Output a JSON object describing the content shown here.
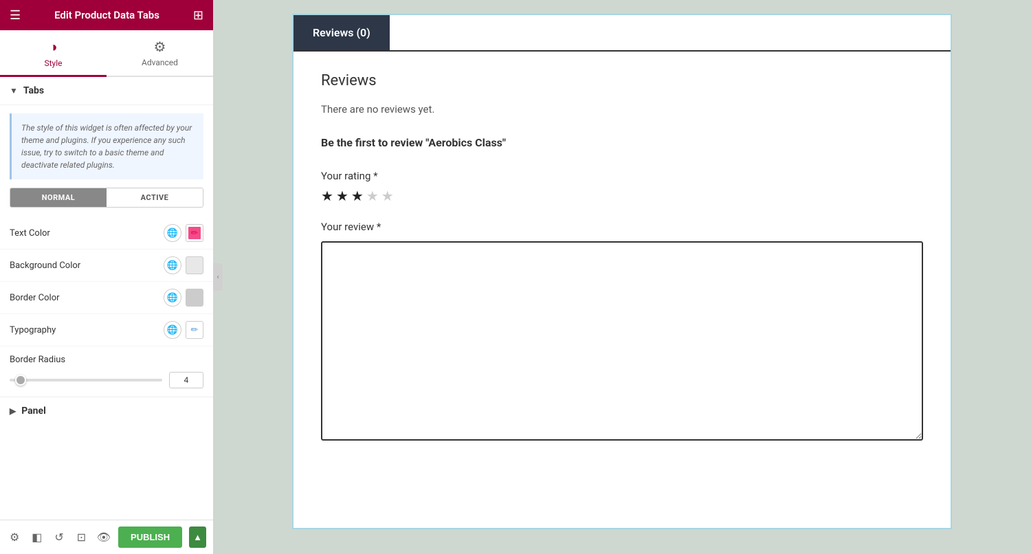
{
  "header": {
    "title": "Edit Product Data Tabs",
    "menu_icon": "☰",
    "apps_icon": "⊞"
  },
  "panel_tabs": [
    {
      "id": "style",
      "label": "Style",
      "icon": "◑",
      "active": true
    },
    {
      "id": "advanced",
      "label": "Advanced",
      "icon": "⚙",
      "active": false
    }
  ],
  "tabs_section": {
    "label": "Tabs",
    "expanded": true
  },
  "info_box": {
    "text": "The style of this widget is often affected by your theme and plugins. If you experience any such issue, try to switch to a basic theme and deactivate related plugins."
  },
  "toggle": {
    "normal": "NORMAL",
    "active": "ACTIVE"
  },
  "properties": {
    "text_color": {
      "label": "Text Color"
    },
    "background_color": {
      "label": "Background Color"
    },
    "border_color": {
      "label": "Border Color"
    },
    "typography": {
      "label": "Typography"
    }
  },
  "border_radius": {
    "label": "Border Radius",
    "value": 4,
    "min": 0,
    "max": 100
  },
  "panel_section": {
    "label": "Panel"
  },
  "bottom_bar": {
    "publish_label": "PUBLISH"
  },
  "preview": {
    "tab_label": "Reviews (0)",
    "reviews_title": "Reviews",
    "no_reviews_text": "There are no reviews yet.",
    "be_first_text": "Be the first to review \"Aerobics Class\"",
    "rating_label": "Your rating *",
    "stars_filled": 3,
    "stars_total": 5,
    "review_label": "Your review *"
  }
}
